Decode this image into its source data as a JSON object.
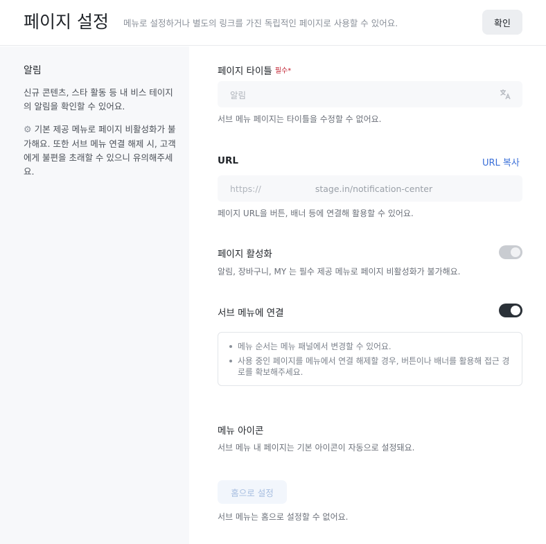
{
  "header": {
    "title": "페이지 설정",
    "description": "메뉴로 설정하거나 별도의 링크를 가진 독립적인 페이지로 사용할 수 있어요.",
    "confirm_label": "확인"
  },
  "sidebar": {
    "title": "알림",
    "description": "신규 콘텐츠, 스타 활동 등 내 비스 테이지의 알림을 확인할 수 있어요.",
    "note_icon": "gear-icon",
    "note": "기본 제공 메뉴로 페이지 비활성화가 불가해요. 또한 서브 메뉴 연결 해제 시, 고객에게 불편을 초래할 수 있으니 유의해주세요."
  },
  "page_title_field": {
    "label": "페이지 타이틀",
    "required_label": "필수*",
    "value": "알림",
    "icon": "translate-icon",
    "helper": "서브 메뉴 페이지는 타이틀을 수정할 수 없어요."
  },
  "url_field": {
    "label": "URL",
    "copy_label": "URL 복사",
    "prefix": "https://",
    "path": "stage.in/notification-center",
    "helper": "페이지 URL을 버튼, 배너 등에 연결해 활용할 수 있어요."
  },
  "activation": {
    "label": "페이지 활성화",
    "helper": "알림, 장바구니, MY 는 필수 제공 메뉴로 페이지 비활성화가 불가해요.",
    "enabled": true,
    "disabled": true
  },
  "submenu": {
    "label": "서브 메뉴에 연결",
    "enabled": true,
    "notices": [
      "메뉴 순서는 메뉴 패널에서 변경할 수 있어요.",
      "사용 중인 페이지를 메뉴에서 연결 해제할 경우, 버튼이나 배너를 활용해 접근 경로를 확보해주세요."
    ]
  },
  "menu_icon": {
    "label": "메뉴 아이콘",
    "helper": "서브 메뉴 내 페이지는 기본 아이콘이 자동으로 설정돼요.",
    "home_button_label": "홈으로 설정",
    "home_helper": "서브 메뉴는 홈으로 설정할 수 없어요."
  },
  "colors": {
    "accent": "#3a6fd8",
    "required": "#c0202f",
    "toggle_on": "#2b3138",
    "toggle_disabled": "#c9ccd1"
  }
}
